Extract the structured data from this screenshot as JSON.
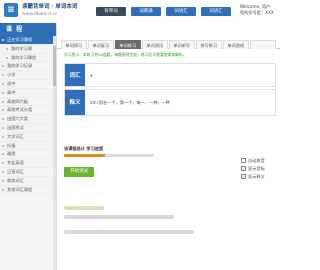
{
  "header": {
    "logo_glyph": "≡",
    "site_title": "读霸背单词 · 单词本词",
    "url": "www.dbword.cn",
    "nav": [
      {
        "label": "背单词",
        "style": "dark"
      },
      {
        "label": "词库通",
        "style": "blue"
      },
      {
        "label": "词语汇",
        "style": "blue"
      },
      {
        "label": "词语汇",
        "style": "blue"
      }
    ],
    "welcome_line1": "Welcome, 用户",
    "welcome_line2": "您的学号是：XXX"
  },
  "sidebar": {
    "title": "课 程",
    "items": [
      {
        "label": "正在学习课程",
        "sub": false,
        "active": true
      },
      {
        "label": "我的学习课",
        "sub": true,
        "active": false
      },
      {
        "label": "我的学习课程",
        "sub": true,
        "active": false
      },
      {
        "label": "我的学习记录",
        "sub": false,
        "active": false
      },
      {
        "label": "小学",
        "sub": false,
        "active": false
      },
      {
        "label": "初中",
        "sub": false,
        "active": false
      },
      {
        "label": "高中",
        "sub": false,
        "active": false
      },
      {
        "label": "高校四六级",
        "sub": false,
        "active": false
      },
      {
        "label": "高校考试分类",
        "sub": false,
        "active": false
      },
      {
        "label": "出国六大类",
        "sub": false,
        "active": false
      },
      {
        "label": "出国考试",
        "sub": false,
        "active": false
      },
      {
        "label": "大学词汇",
        "sub": false,
        "active": false
      },
      {
        "label": "托福",
        "sub": false,
        "active": false
      },
      {
        "label": "雅思",
        "sub": false,
        "active": false
      },
      {
        "label": "专业英语",
        "sub": false,
        "active": false
      },
      {
        "label": "日语词汇",
        "sub": false,
        "active": false
      },
      {
        "label": "商务词汇",
        "sub": false,
        "active": false
      },
      {
        "label": "其他词汇课程",
        "sub": false,
        "active": false
      }
    ]
  },
  "tabs": [
    {
      "label": "单词预习",
      "active": false
    },
    {
      "label": "单词复习",
      "active": false
    },
    {
      "label": "单词练习",
      "active": true
    },
    {
      "label": "单词测试",
      "active": false
    },
    {
      "label": "单词听写",
      "active": false
    },
    {
      "label": "拼写练习",
      "active": false
    },
    {
      "label": "单词游戏",
      "active": false
    },
    {
      "label": "",
      "active": false
    }
  ],
  "notice": "学习提示：本练习共50道题，每题限时完成，练习后可查看答案和解析。",
  "word_card": {
    "label": "词汇",
    "word": "a"
  },
  "meaning_card": {
    "label": "释义",
    "text": "art.(用在一个，第一个，每一，一种，一种"
  },
  "progress": {
    "label": "该课程总计 学习进度",
    "fraction": 0.46
  },
  "options": [
    {
      "label": "自动发音",
      "checked": false
    },
    {
      "label": "显示音标",
      "checked": true
    },
    {
      "label": "显示释义",
      "checked": true
    }
  ],
  "action_button": "开始测试",
  "colors": {
    "brand_blue": "#2f6fb8",
    "nav_dark": "#3a4a5a",
    "green": "#67b52b",
    "progress": "#e08a1c"
  }
}
